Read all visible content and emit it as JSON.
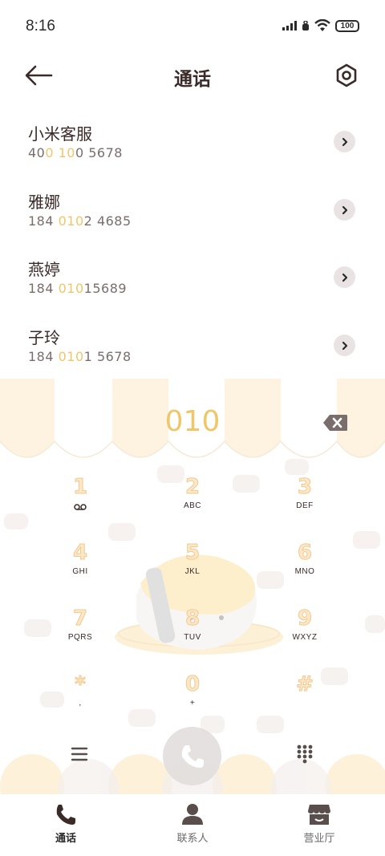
{
  "status_bar": {
    "time": "8:16",
    "battery": "100"
  },
  "header": {
    "title": "通话"
  },
  "contacts": [
    {
      "name": "小米客服",
      "num_a": "40",
      "num_hl": "0 10",
      "num_b": "0 5678"
    },
    {
      "name": "雅娜",
      "num_a": "184 ",
      "num_hl": "010",
      "num_b": "2 4685"
    },
    {
      "name": "燕婷",
      "num_a": "184 ",
      "num_hl": "010",
      "num_b": "15689"
    },
    {
      "name": "子玲",
      "num_a": "184 ",
      "num_hl": "010",
      "num_b": "1 5678"
    }
  ],
  "dialpad": {
    "input": "010",
    "keys": [
      {
        "digit": "1",
        "letters": ""
      },
      {
        "digit": "2",
        "letters": "ABC"
      },
      {
        "digit": "3",
        "letters": "DEF"
      },
      {
        "digit": "4",
        "letters": "GHI"
      },
      {
        "digit": "5",
        "letters": "JKL"
      },
      {
        "digit": "6",
        "letters": "MNO"
      },
      {
        "digit": "7",
        "letters": "PQRS"
      },
      {
        "digit": "8",
        "letters": "TUV"
      },
      {
        "digit": "9",
        "letters": "WXYZ"
      },
      {
        "digit": "*",
        "letters": ","
      },
      {
        "digit": "0",
        "letters": "+"
      },
      {
        "digit": "#",
        "letters": ""
      }
    ]
  },
  "nav": {
    "items": [
      {
        "label": "通话",
        "icon": "phone-icon"
      },
      {
        "label": "联系人",
        "icon": "person-icon"
      },
      {
        "label": "营业厅",
        "icon": "store-icon"
      }
    ]
  },
  "colors": {
    "accent": "#f0c66a",
    "text": "#3a2a28",
    "awning": "#fdf3e0"
  }
}
